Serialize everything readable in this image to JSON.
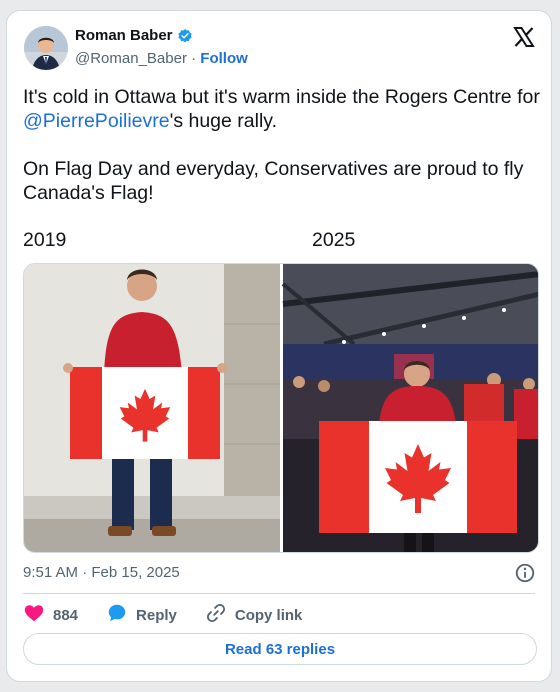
{
  "author": {
    "name": "Roman Baber",
    "handle": "@Roman_Baber",
    "separator": "·",
    "follow_label": "Follow",
    "verified_color": "#1d9bf0"
  },
  "tweet": {
    "line1_prefix": "It's cold in Ottawa but it's warm inside the Rogers Centre for ",
    "mention": "@PierrePoilievre",
    "line1_suffix": "'s huge rally.",
    "paragraph2": "On Flag Day and everyday, Conservatives are proud to fly Canada's Flag!",
    "year_left": "2019",
    "year_right": "2025"
  },
  "meta": {
    "timestamp": "9:51 AM · Feb 15, 2025"
  },
  "actions": {
    "like_count": "884",
    "reply_label": "Reply",
    "copy_label": "Copy link"
  },
  "read_replies_label": "Read 63 replies",
  "colors": {
    "accent": "#1d6fd8",
    "like": "#f91880",
    "flag_red": "#e8322b"
  },
  "icons": {
    "brand": "x-logo-icon",
    "info": "info-icon",
    "like": "heart-icon",
    "reply": "speech-bubble-icon",
    "copy": "link-icon"
  }
}
